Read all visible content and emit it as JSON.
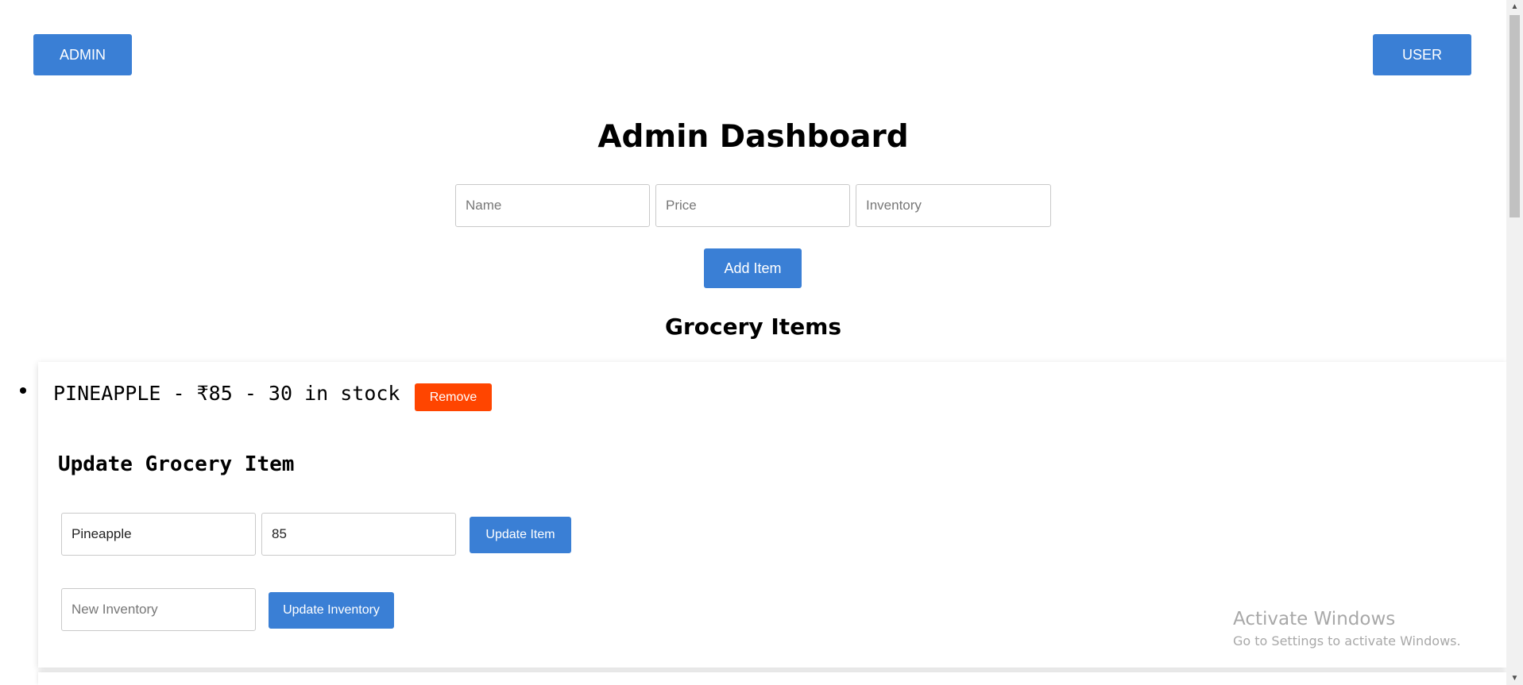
{
  "header": {
    "admin_label": "ADMIN",
    "user_label": "USER"
  },
  "page": {
    "title": "Admin Dashboard"
  },
  "add_form": {
    "name_placeholder": "Name",
    "price_placeholder": "Price",
    "inventory_placeholder": "Inventory",
    "add_label": "Add Item"
  },
  "grocery": {
    "title": "Grocery Items",
    "items": [
      {
        "text": "PINEAPPLE - ₹85 - 30 in stock",
        "remove_label": "Remove",
        "update": {
          "title": "Update Grocery Item",
          "name_value": "Pineapple",
          "price_value": "85",
          "update_label": "Update Item",
          "inventory_placeholder": "New Inventory",
          "update_inventory_label": "Update Inventory"
        }
      }
    ]
  },
  "watermark": {
    "title": "Activate Windows",
    "subtitle": "Go to Settings to activate Windows."
  },
  "colors": {
    "primary": "#3a7fd5",
    "danger": "#ff4500"
  },
  "icons": {
    "scroll_up": "chevron-up-icon",
    "scroll_down": "chevron-down-icon"
  }
}
